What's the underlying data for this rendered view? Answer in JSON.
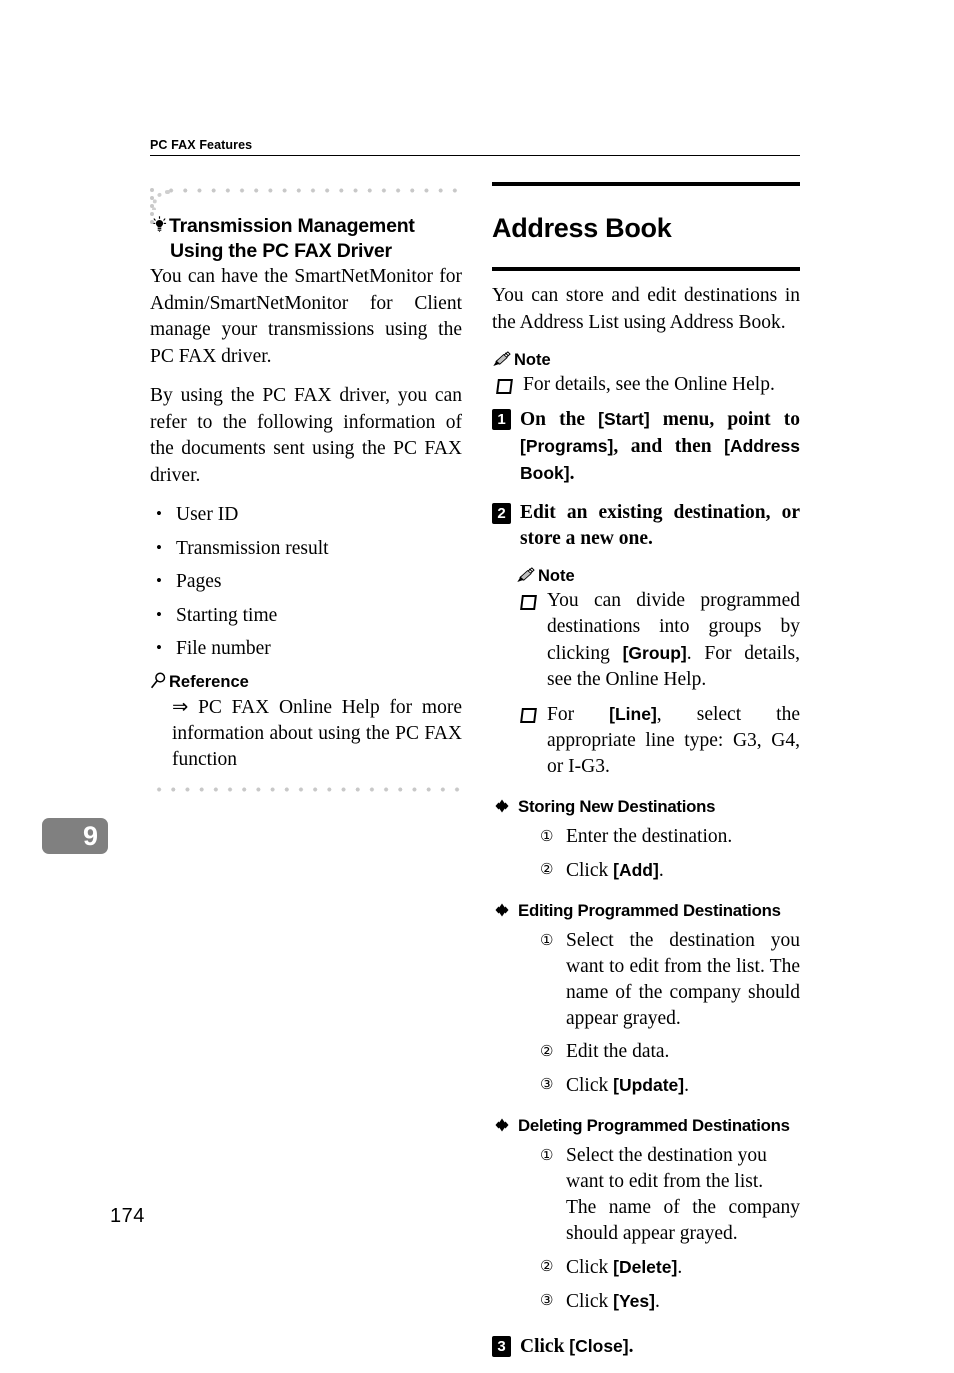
{
  "running_head": {
    "text": "PC FAX Features"
  },
  "chapter_tab": {
    "number": "9"
  },
  "page_number": "174",
  "left_column": {
    "tip": {
      "icon": "lightbulb-icon",
      "title_line1": "Transmission Management",
      "title_line2": "Using the PC FAX Driver",
      "paragraphs": [
        "You can have the SmartNetMonitor for Admin/SmartNetMonitor for Client manage your transmissions using the PC FAX driver.",
        "By using the PC FAX driver, you can refer to the following information of the documents sent using the PC FAX driver."
      ],
      "bullets": [
        "User ID",
        "Transmission result",
        "Pages",
        "Starting time",
        "File number"
      ],
      "reference": {
        "icon": "magnifier-icon",
        "label": "Reference",
        "body": "⇒ PC FAX Online Help for more information about using the PC FAX function"
      }
    }
  },
  "right_column": {
    "section_title": "Address Book",
    "intro": "You can store and edit destinations in the Address List using Address Book.",
    "note1": {
      "icon": "pencil-icon",
      "label": "Note",
      "items": [
        "For details, see the Online Help."
      ]
    },
    "steps": [
      {
        "num": "1",
        "parts": [
          {
            "t": "On the ",
            "kb": false
          },
          {
            "t": "[Start]",
            "kb": true
          },
          {
            "t": " menu, point to ",
            "kb": false
          },
          {
            "t": "[Programs]",
            "kb": true
          },
          {
            "t": ", and then ",
            "kb": false
          },
          {
            "t": "[Address Book]",
            "kb": true
          },
          {
            "t": ".",
            "kb": false
          }
        ],
        "plain": "On the [Start] menu, point to [Programs], and then [Address Book]."
      },
      {
        "num": "2",
        "plain": "Edit an existing destination, or store a new one."
      },
      {
        "num": "3",
        "plain": "Click [Close]."
      }
    ],
    "note2": {
      "icon": "pencil-icon",
      "label": "Note",
      "items": [
        "You can divide programmed destinations into groups by clicking [Group]. For details, see the Online Help.",
        "For [Line], select the appropriate line type: G3, G4, or I-G3."
      ]
    },
    "subsections": [
      {
        "icon": "diamond-icon",
        "title": "Storing New Destinations",
        "items": [
          {
            "num": "①",
            "text": "Enter the destination."
          },
          {
            "num": "②",
            "text": "Click [Add]."
          }
        ]
      },
      {
        "icon": "diamond-icon",
        "title": "Editing Programmed Destinations",
        "items": [
          {
            "num": "①",
            "text": "Select the destination you want to edit from the list. The name of the company should appear grayed."
          },
          {
            "num": "②",
            "text": "Edit the data."
          },
          {
            "num": "③",
            "text": "Click [Update]."
          }
        ]
      },
      {
        "icon": "diamond-icon",
        "title": "Deleting Programmed Destinations",
        "items": [
          {
            "num": "①",
            "text": "Select the destination you want to edit from the list. The name of the company should appear grayed."
          },
          {
            "num": "②",
            "text": "Click [Delete]."
          },
          {
            "num": "③",
            "text": "Click [Yes]."
          }
        ]
      }
    ]
  },
  "colors": {
    "text": "#000000",
    "tab_gray": "#808080",
    "dot_gray": "#c8c8c8"
  }
}
